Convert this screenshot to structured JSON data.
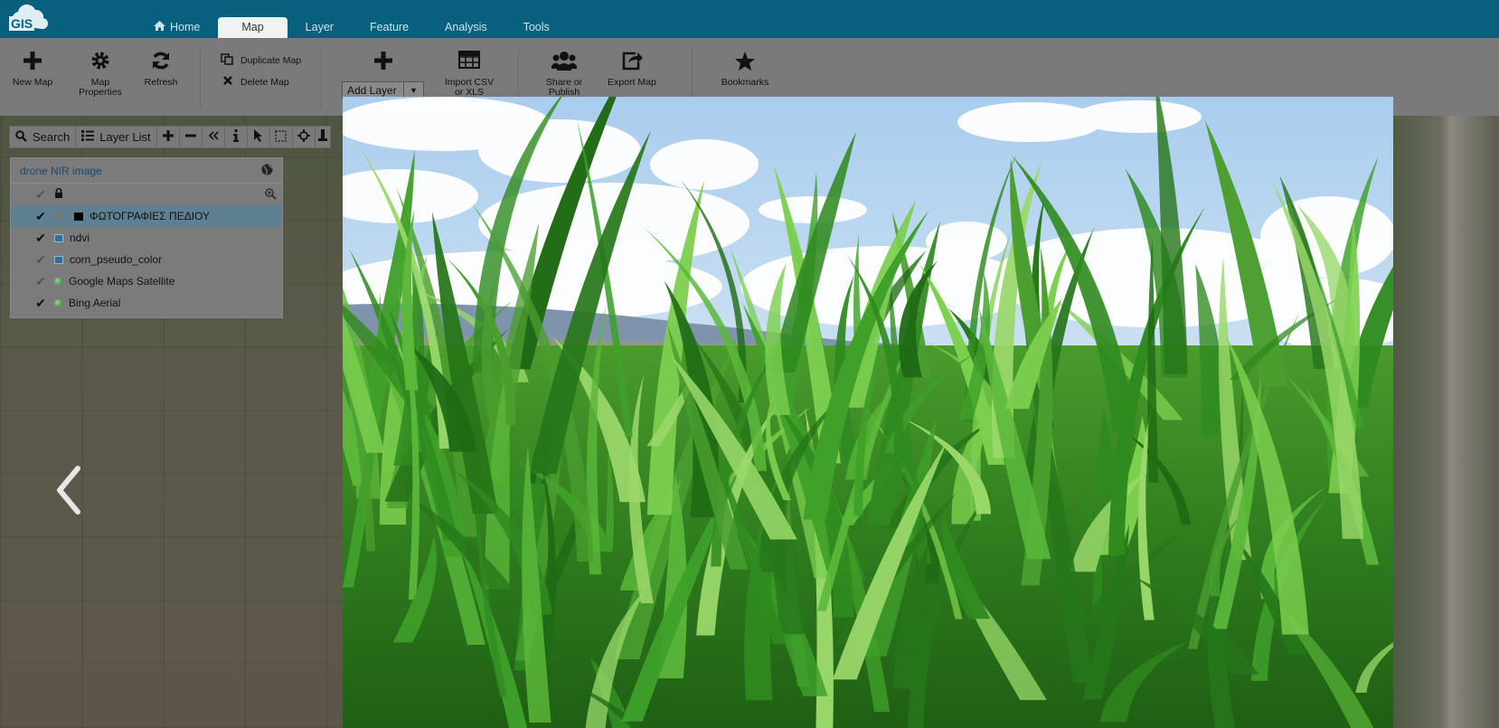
{
  "app": {
    "logo_text": "GIS",
    "tabs": [
      {
        "label": "Home",
        "icon": "home-icon"
      },
      {
        "label": "Map"
      },
      {
        "label": "Layer"
      },
      {
        "label": "Feature"
      },
      {
        "label": "Analysis"
      },
      {
        "label": "Tools"
      }
    ],
    "active_tab": "Map"
  },
  "ribbon": {
    "new_map": "New Map",
    "map_properties_line1": "Map",
    "map_properties_line2": "Properties",
    "refresh": "Refresh",
    "duplicate_map": "Duplicate Map",
    "delete_map": "Delete Map",
    "add_layer": "Add Layer",
    "import_csv_line1": "Import CSV",
    "import_csv_line2": "or XLS",
    "share_line1": "Share or",
    "share_line2": "Publish",
    "export_map": "Export Map",
    "bookmarks": "Bookmarks"
  },
  "toolstrip": {
    "search": "Search",
    "layer_list": "Layer List"
  },
  "layer_panel": {
    "title": "drone NIR image",
    "layers": [
      {
        "name": "ΦΩΤΟΓΡΑΦΙΕΣ ΠΕΔΙΟΥ",
        "checked": true,
        "selected": true,
        "swatch": "#000000"
      },
      {
        "name": "ndvi",
        "checked": true,
        "swatch": "#2e6ea0"
      },
      {
        "name": "corn_pseudo_color",
        "checked": false,
        "swatch": "#2e6ea0"
      },
      {
        "name": "Google Maps Satellite",
        "checked": false,
        "swatch": "dot"
      },
      {
        "name": "Bing Aerial",
        "checked": true,
        "swatch": "dot"
      }
    ]
  },
  "colors": {
    "topbar": "#08607e",
    "tab_active_bg": "#f2f2f2",
    "layer_title": "#1c4a70"
  }
}
